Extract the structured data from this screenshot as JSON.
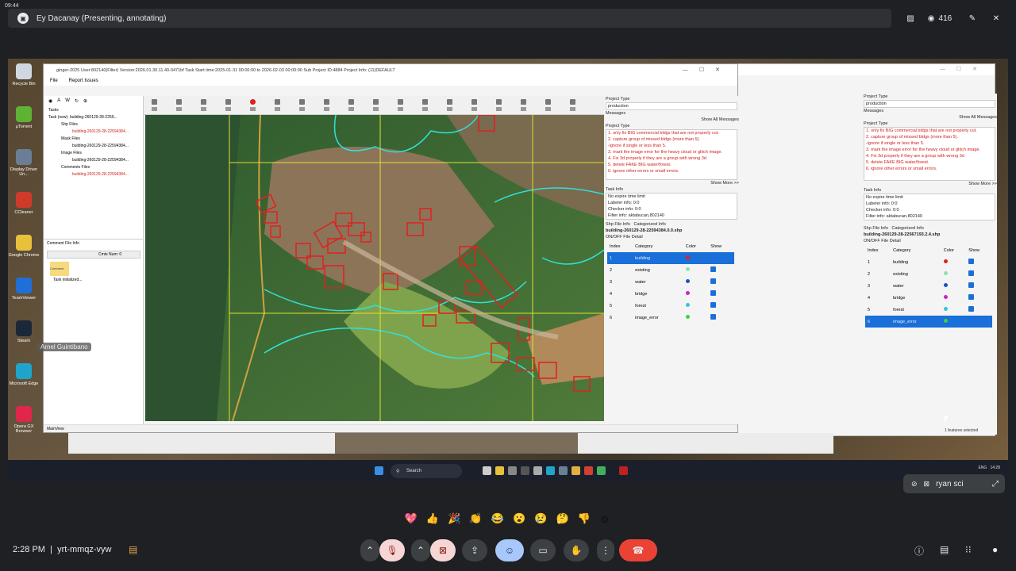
{
  "meeting": {
    "clock_small": "09:44",
    "presenter": "Ey Dacanay (Presenting, annotating)",
    "participants": "416",
    "time": "2:28 PM",
    "code": "yrt-mmqz-vyw",
    "self_name": "ryan sci",
    "annotator_label": "Arnel Guintibano"
  },
  "desktop_icons": [
    {
      "label": "Recycle Bin",
      "color": "#cfd8e0"
    },
    {
      "label": "µTorrent",
      "color": "#5fb233"
    },
    {
      "label": "Display Driver Un...",
      "color": "#6a7f95"
    },
    {
      "label": "CCleaner",
      "color": "#d03a2a"
    },
    {
      "label": "Google Chrome",
      "color": "#e8c13a"
    },
    {
      "label": "TeamViewer",
      "color": "#1f6fd8"
    },
    {
      "label": "Steam",
      "color": "#1b2838"
    },
    {
      "label": "Microsoft Edge",
      "color": "#1fa5c9"
    },
    {
      "label": "Opera GX Browser",
      "color": "#e0264a"
    }
  ],
  "app": {
    "title": "ginger-2025   User:802140(Filter)   Version:2026.01.30.11.40-0471bf   Task Start time:2025-01-31 00:00:00 to 2026-02-03 00:00:00   Sub Project ID:4884   Project Info: (11)DEFAULT",
    "menu": [
      "File",
      "Report Issues"
    ],
    "status": "MainView",
    "tree": {
      "root": "Tasks",
      "task": "Task (new): building-260129-28-2259...",
      "shp_group": "Shp Files",
      "shp_file": "building-260129-28-22594384...",
      "mask_group": "Mask Files",
      "mask_file": "building-260129-28-22594384...",
      "image_group": "Image Files",
      "image_file": "building-260129-28-22594384...",
      "comment_group": "Comments Files",
      "comment_file": "building-260129-28-22594384..."
    },
    "comment": {
      "header": "Comment File Info",
      "count": "Cmts Num:  0",
      "note": "Comment",
      "status": "Task initialized..."
    }
  },
  "right_panel": {
    "project_type_label": "Project Type",
    "project_type_value": "production",
    "messages_label": "Messages",
    "show_all": "Show All Messages",
    "project_type2_label": "Project Type",
    "messages": [
      "1. only fix BIG commercial bldgs that are not properly cut.",
      "2. capture group of missed bldgs (more than 5).",
      "-ignore if single or less than 5.",
      "3. mark the image error for the heavy cloud or glitch image.",
      "4. Fix 3d properly if they are a group with wrong 3d",
      "5. delete FAKE BIG water/forest.",
      "6. ignore other errors or small errors."
    ],
    "show_more": "Show More >>",
    "task_info_label": "Task Info",
    "task_info": [
      "No expire time limit",
      "Labeler info: 0:0",
      "Checker info: 0:0",
      "Filter info: aktabucan,802140"
    ],
    "tabs": [
      "Shp File Info",
      "Categorized Info"
    ],
    "file_name": "building-260129-28-22594384.0.0.shp",
    "onoff": "ON/OFF File Detail",
    "headers": [
      "Index",
      "Category",
      "Color",
      "Show"
    ],
    "rows": [
      {
        "index": "1",
        "category": "building",
        "color": "#e02020"
      },
      {
        "index": "2",
        "category": "existing",
        "color": "#8ee0b0"
      },
      {
        "index": "3",
        "category": "water",
        "color": "#1a4fd0"
      },
      {
        "index": "4",
        "category": "bridge",
        "color": "#d020d0"
      },
      {
        "index": "5",
        "category": "forest",
        "color": "#30c8d8"
      },
      {
        "index": "6",
        "category": "image_error",
        "color": "#40d040"
      }
    ]
  },
  "right_panel2": {
    "file_name": "building-260129-28-22567193.2.4.shp",
    "footer": "1 features selected"
  },
  "taskbar": {
    "search": "Search",
    "lang": "ENG",
    "time": "14:28"
  }
}
